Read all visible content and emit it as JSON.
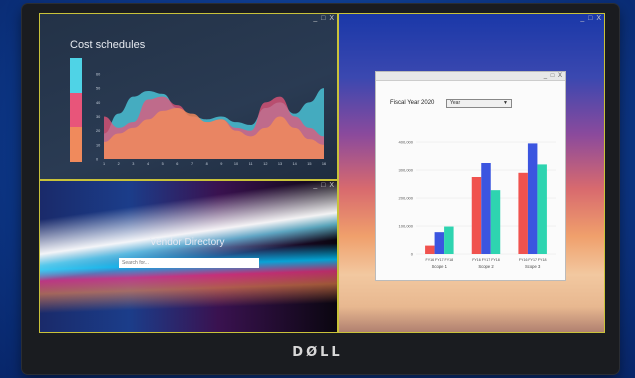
{
  "device": {
    "logo": "DØLL"
  },
  "window_controls": "_ □ X",
  "cost_window": {
    "title": "Cost schedules",
    "legend_colors": [
      "#4fd3e6",
      "#e8557a",
      "#f08a5c"
    ],
    "chart_data": {
      "type": "area",
      "title": "",
      "x": [
        1,
        2,
        3,
        4,
        5,
        6,
        7,
        8,
        9,
        10,
        11,
        12,
        13,
        14,
        15,
        16
      ],
      "ylim": [
        0,
        60
      ],
      "yticks": [
        0,
        10,
        20,
        30,
        40,
        50,
        60
      ],
      "series": [
        {
          "color": "#4fd3e6",
          "values": [
            18,
            32,
            44,
            48,
            46,
            36,
            30,
            28,
            30,
            26,
            24,
            36,
            40,
            32,
            40,
            50
          ]
        },
        {
          "color": "#e8557a",
          "values": [
            30,
            22,
            26,
            42,
            44,
            38,
            30,
            26,
            28,
            22,
            20,
            40,
            44,
            30,
            22,
            16
          ]
        },
        {
          "color": "#f08a5c",
          "values": [
            12,
            18,
            22,
            28,
            34,
            36,
            32,
            26,
            28,
            20,
            16,
            22,
            30,
            22,
            14,
            10
          ]
        }
      ]
    }
  },
  "vendor_window": {
    "title": "Vendor Directory",
    "search_placeholder": "Search for..."
  },
  "fiscal_window": {
    "label": "Fiscal Year 2020",
    "select_value": "Year",
    "chart_data": {
      "type": "bar",
      "title": "",
      "categories": [
        "Scope 1",
        "Scope 2",
        "Scope 3"
      ],
      "sub_labels": [
        "FY16",
        "FY17",
        "FY18"
      ],
      "ylim": [
        0,
        400000
      ],
      "yticks": [
        "0",
        "100,000",
        "200,000",
        "300,000",
        "400,000"
      ],
      "series": [
        {
          "color": "#f0524e",
          "values": [
            30000,
            275000,
            290000
          ]
        },
        {
          "color": "#3b55e0",
          "values": [
            78000,
            325000,
            395000
          ]
        },
        {
          "color": "#2ed4b0",
          "values": [
            98000,
            228000,
            320000
          ]
        }
      ]
    }
  }
}
